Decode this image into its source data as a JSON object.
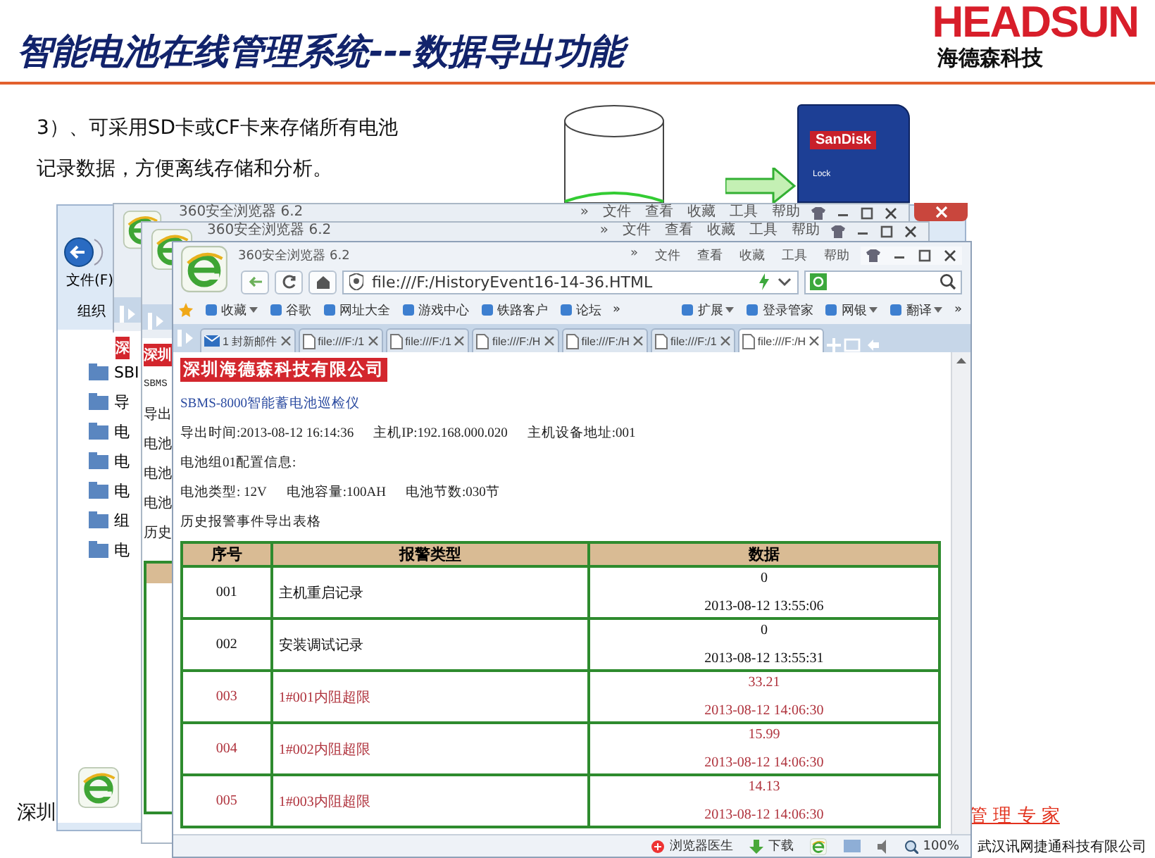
{
  "slide": {
    "title": "智能电池在线管理系统---数据导出功能",
    "logo": {
      "brand": "HEADSUN",
      "subtitle": "海德森科技"
    },
    "body_lines": [
      "3）、可采用SD卡或CF卡来存储所有电池",
      "记录数据，方便离线存储和分析。"
    ],
    "sd_card": {
      "brand": "SanDisk",
      "lock": "Lock"
    },
    "footer_left": "深圳",
    "slogan": "管 理 专 家",
    "company": "武汉讯网捷通科技有限公司"
  },
  "explorer": {
    "menu": "文件(F)",
    "toolbar": "组织",
    "tree": [
      "SBI",
      "导",
      "电",
      "电",
      "电",
      "组",
      "电"
    ]
  },
  "back_browsers": [
    {
      "title": "360安全浏览器 6.2",
      "menu": [
        "»",
        "文件",
        "查看",
        "收藏",
        "工具",
        "帮助"
      ],
      "content": [
        {
          "kind": "company",
          "text": "深"
        }
      ]
    },
    {
      "title": "360安全浏览器 6.2",
      "menu": [
        "»",
        "文件",
        "查看",
        "收藏",
        "工具",
        "帮助"
      ],
      "content": [
        {
          "kind": "company",
          "text": "深圳"
        },
        {
          "kind": "line",
          "text": "SBMS"
        },
        {
          "kind": "line",
          "text": "导出"
        },
        {
          "kind": "line",
          "text": "电池"
        },
        {
          "kind": "line",
          "text": "电池"
        },
        {
          "kind": "line",
          "text": "电池"
        },
        {
          "kind": "line",
          "text": "历史"
        }
      ]
    }
  ],
  "browser": {
    "title": "360安全浏览器 6.2",
    "menu": [
      "»",
      "文件",
      "查看",
      "收藏",
      "工具",
      "帮助"
    ],
    "address": "file:///F:/HistoryEvent16-14-36.HTML",
    "bookmarks": [
      {
        "label": "收藏",
        "dropdown": true
      },
      {
        "label": "谷歌",
        "dropdown": false
      },
      {
        "label": "网址大全",
        "dropdown": false
      },
      {
        "label": "游戏中心",
        "dropdown": false
      },
      {
        "label": "铁路客户",
        "dropdown": false
      },
      {
        "label": "论坛",
        "dropdown": false
      }
    ],
    "bookmarks_more": "»",
    "extensions": [
      {
        "label": "扩展",
        "dropdown": true
      },
      {
        "label": "登录管家",
        "dropdown": false
      },
      {
        "label": "网银",
        "dropdown": true
      },
      {
        "label": "翻译",
        "dropdown": true
      }
    ],
    "extensions_more": "»",
    "tabs": [
      {
        "label": "1 封新邮件",
        "selected": false
      },
      {
        "label": "file:///F:/1",
        "selected": false
      },
      {
        "label": "file:///F:/1",
        "selected": false
      },
      {
        "label": "file:///F:/H",
        "selected": false
      },
      {
        "label": "file:///F:/H",
        "selected": false
      },
      {
        "label": "file:///F:/1",
        "selected": false
      },
      {
        "label": "file:///F:/H",
        "selected": true
      }
    ],
    "page": {
      "company": "深圳海德森科技有限公司",
      "product": "SBMS-8000智能蓄电池巡检仪",
      "info_lines": [
        [
          "导出时间:2013-08-12 16:14:36",
          "主机IP:192.168.000.020",
          "主机设备地址:001"
        ],
        [
          "电池组01配置信息:"
        ],
        [
          "电池类型: 12V",
          "电池容量:100AH",
          "电池节数:030节"
        ],
        [
          "历史报警事件导出表格"
        ]
      ],
      "table": {
        "columns": [
          "序号",
          "报警类型",
          "数据"
        ],
        "rows": [
          {
            "kind": "normal",
            "no": "001",
            "type": "主机重启记录",
            "value": "0",
            "time": "2013-08-12 13:55:06"
          },
          {
            "kind": "normal",
            "no": "002",
            "type": "安装调试记录",
            "value": "0",
            "time": "2013-08-12 13:55:31"
          },
          {
            "kind": "alarm",
            "no": "003",
            "type": "1#001内阻超限",
            "value": "33.21",
            "time": "2013-08-12 14:06:30"
          },
          {
            "kind": "alarm",
            "no": "004",
            "type": "1#002内阻超限",
            "value": "15.99",
            "time": "2013-08-12 14:06:30"
          },
          {
            "kind": "alarm",
            "no": "005",
            "type": "1#003内阻超限",
            "value": "14.13",
            "time": "2013-08-12 14:06:30"
          }
        ]
      }
    },
    "status_bar": {
      "doctor": "浏览器医生",
      "download": "下载",
      "zoom": "100%"
    }
  }
}
